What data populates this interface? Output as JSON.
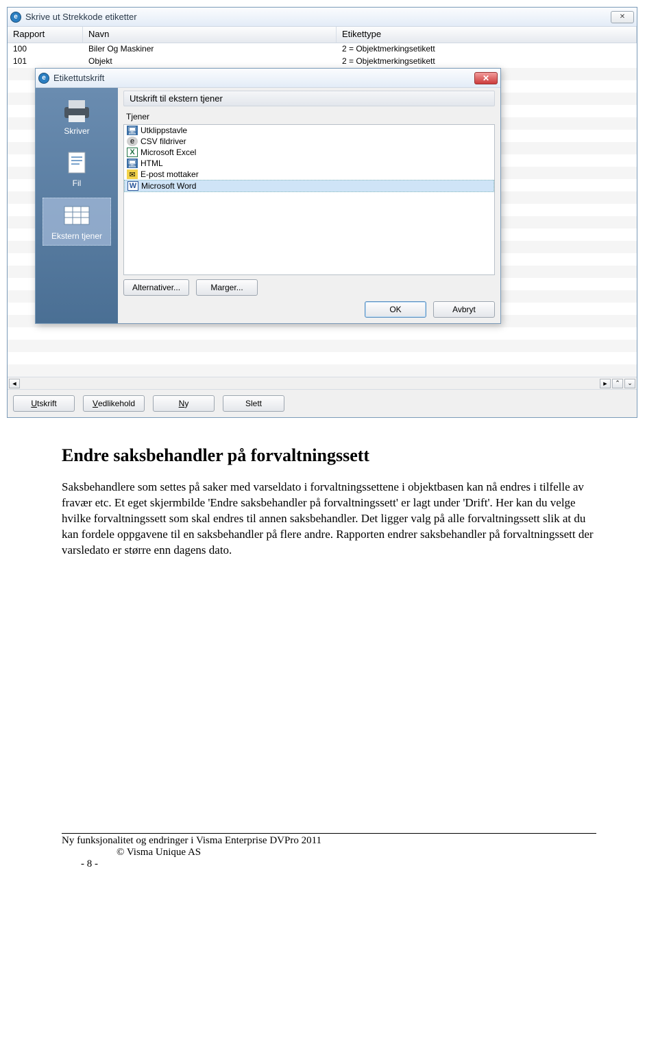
{
  "outer_dialog": {
    "title": "Skrive ut Strekkode etiketter",
    "columns": {
      "rapport": "Rapport",
      "navn": "Navn",
      "etikett": "Etikettype"
    },
    "rows": [
      {
        "rapport": "100",
        "navn": "Biler Og Maskiner",
        "etikett": "2 = Objektmerkingsetikett"
      },
      {
        "rapport": "101",
        "navn": "Objekt",
        "etikett": "2 = Objektmerkingsetikett"
      }
    ],
    "buttons": {
      "utskrift": "Utskrift",
      "vedlikehold": "Vedlikehold",
      "ny": "Ny",
      "slett": "Slett"
    }
  },
  "inner_dialog": {
    "title": "Etikettutskrift",
    "sidebar": {
      "skriver": "Skriver",
      "fil": "Fil",
      "ekstern": "Ekstern tjener"
    },
    "main_title": "Utskrift til ekstern tjener",
    "group_label": "Tjener",
    "items": [
      "Utklippstavle",
      "CSV fildriver",
      "Microsoft Excel",
      "HTML",
      "E-post mottaker",
      "Microsoft Word"
    ],
    "buttons": {
      "alternativer": "Alternativer...",
      "marger": "Marger...",
      "ok": "OK",
      "avbryt": "Avbryt"
    }
  },
  "doc": {
    "heading": "Endre saksbehandler på forvaltningssett",
    "paragraph": "Saksbehandlere som settes på saker med varseldato i forvaltningssettene i objektbasen kan nå endres i tilfelle av fravær etc. Et eget skjermbilde 'Endre saksbehandler på forvaltningssett' er lagt under 'Drift'. Her kan du velge hvilke forvaltningssett som skal endres til annen saksbehandler. Det ligger valg på alle forvaltningssett slik at du kan fordele oppgavene til en saksbehandler på flere andre. Rapporten endrer saksbehandler på forvaltningssett der varsledato er større enn dagens dato."
  },
  "footer": {
    "line1": "Ny funksjonalitet og endringer i Visma Enterprise DVPro 2011",
    "line2": "© Visma Unique AS",
    "line3": "- 8 -"
  }
}
